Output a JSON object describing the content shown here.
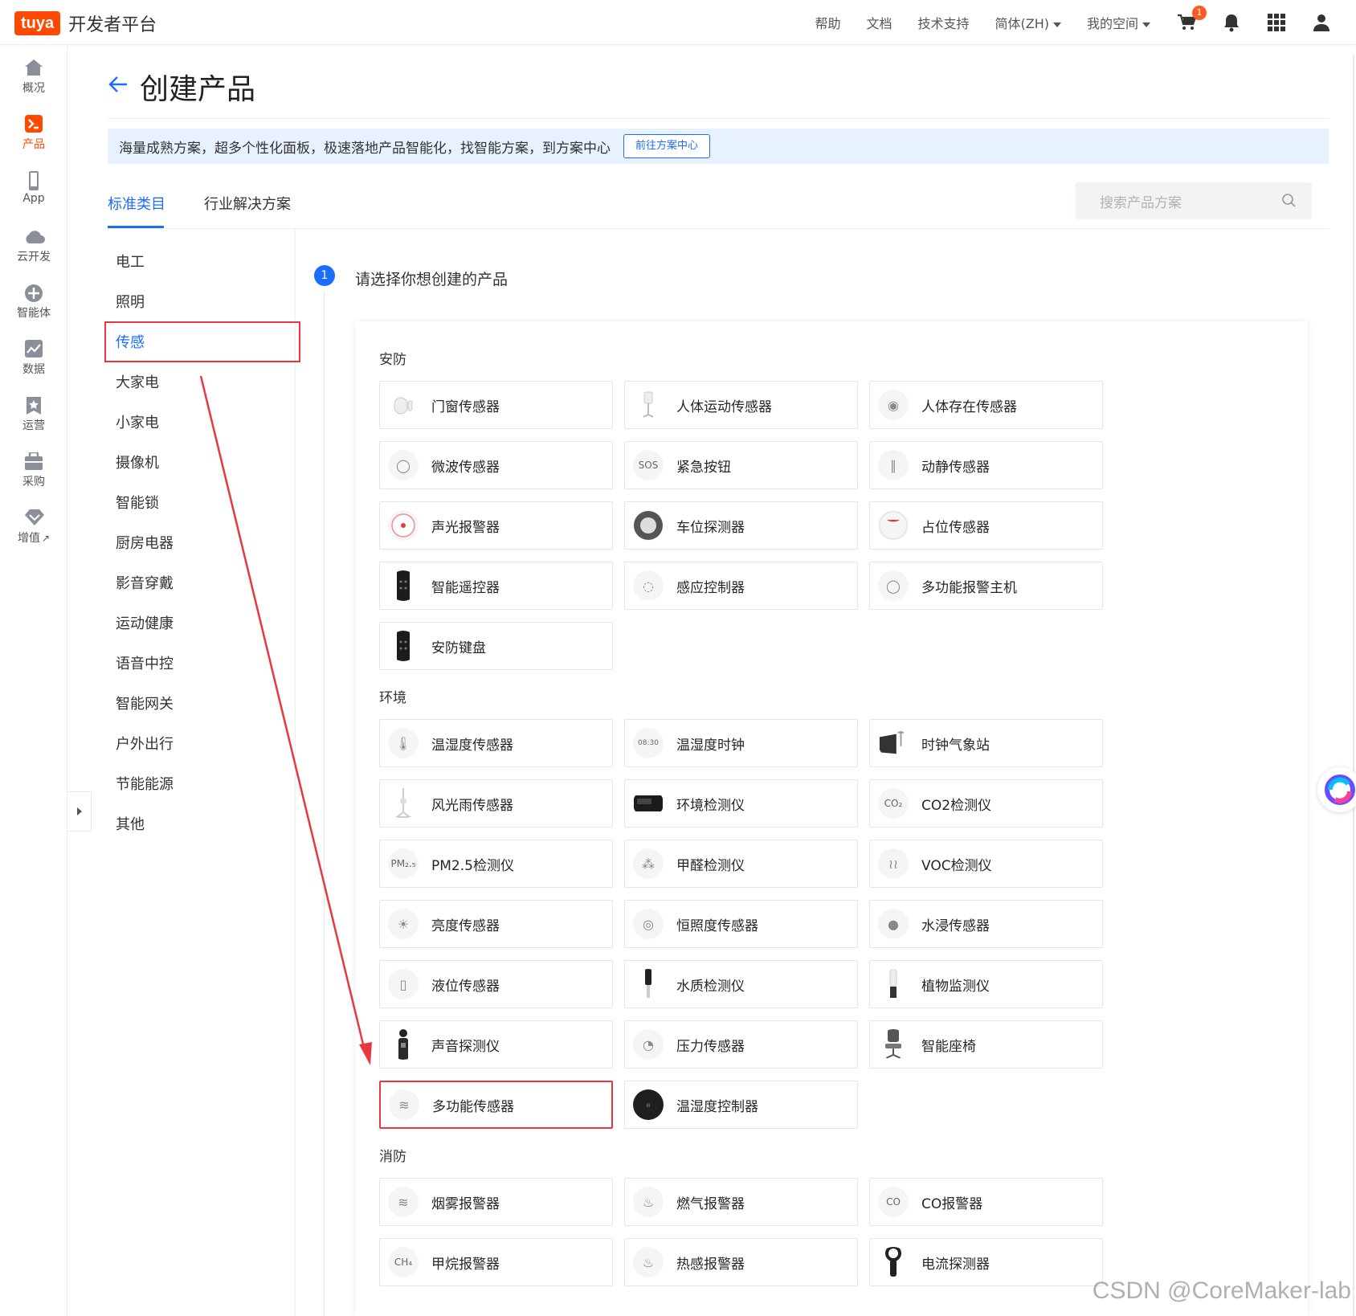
{
  "header": {
    "logo_badge": "tuya",
    "logo_text": "开发者平台",
    "nav": [
      "帮助",
      "文档",
      "技术支持",
      "简体(ZH)",
      "我的空间"
    ],
    "cart_count": "1"
  },
  "sidebar": {
    "items": [
      {
        "label": "概况",
        "icon": "home-icon"
      },
      {
        "label": "产品",
        "icon": "product-icon",
        "active": true
      },
      {
        "label": "App",
        "icon": "phone-icon"
      },
      {
        "label": "云开发",
        "icon": "cloud-icon"
      },
      {
        "label": "智能体",
        "icon": "agent-icon"
      },
      {
        "label": "数据",
        "icon": "chart-icon"
      },
      {
        "label": "运营",
        "icon": "star-icon"
      },
      {
        "label": "采购",
        "icon": "purchase-icon"
      },
      {
        "label": "增值",
        "icon": "diamond-icon"
      }
    ]
  },
  "page": {
    "title": "创建产品",
    "banner_text": "海量成熟方案，超多个性化面板，极速落地产品智能化，找智能方案，到方案中心",
    "banner_button": "前往方案中心",
    "tabs": [
      "标准类目",
      "行业解决方案"
    ],
    "search_placeholder": "搜索产品方案",
    "step_number": "1",
    "step_text": "请选择你想创建的产品"
  },
  "categories": [
    "电工",
    "照明",
    "传感",
    "大家电",
    "小家电",
    "摄像机",
    "智能锁",
    "厨房电器",
    "影音穿戴",
    "运动健康",
    "语音中控",
    "智能网关",
    "户外出行",
    "节能能源",
    "其他"
  ],
  "groups": [
    {
      "title": "安防",
      "products": [
        "门窗传感器",
        "人体运动传感器",
        "人体存在传感器",
        "微波传感器",
        "紧急按钮",
        "动静传感器",
        "声光报警器",
        "车位探测器",
        "占位传感器",
        "智能遥控器",
        "感应控制器",
        "多功能报警主机",
        "安防键盘"
      ]
    },
    {
      "title": "环境",
      "products": [
        "温湿度传感器",
        "温湿度时钟",
        "时钟气象站",
        "风光雨传感器",
        "环境检测仪",
        "CO2检测仪",
        "PM2.5检测仪",
        "甲醛检测仪",
        "VOC检测仪",
        "亮度传感器",
        "恒照度传感器",
        "水浸传感器",
        "液位传感器",
        "水质检测仪",
        "植物监测仪",
        "声音探测仪",
        "压力传感器",
        "智能座椅",
        "多功能传感器",
        "温湿度控制器"
      ]
    },
    {
      "title": "消防",
      "products": [
        "烟雾报警器",
        "燃气报警器",
        "CO报警器",
        "甲烷报警器",
        "热感报警器",
        "电流探测器"
      ]
    }
  ],
  "icon_text": {
    "sos": "SOS",
    "co2": "CO₂",
    "pm": "PM₂.₅",
    "co": "CO",
    "ch4": "CH₄",
    "clock": "08:30"
  },
  "watermark": "CSDN @CoreMaker-lab",
  "colors": {
    "brand": "#ff4800",
    "accent": "#1a6dff",
    "highlight": "#e8383d"
  }
}
